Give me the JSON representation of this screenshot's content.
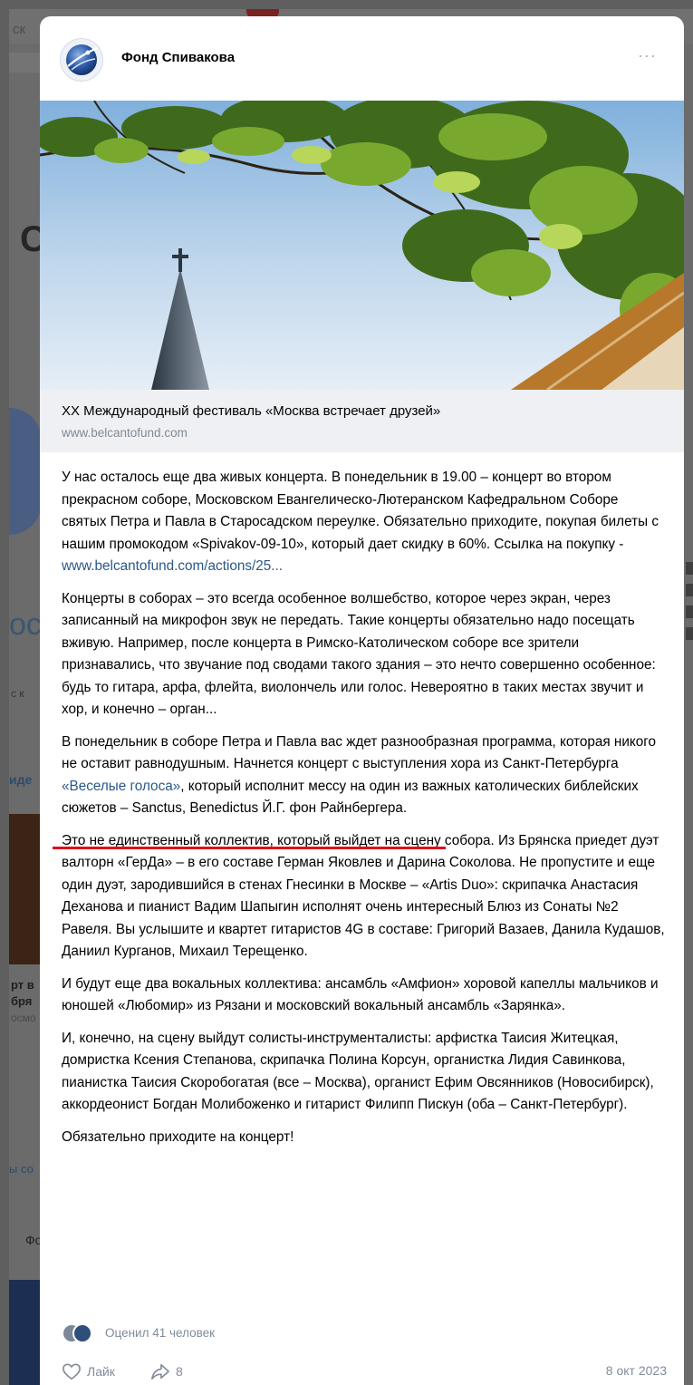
{
  "background": {
    "search_fragment": "ск",
    "big_letter": "С",
    "side_text_oc": "ос",
    "side_text_sk": "с к",
    "side_text_ide": "иде",
    "side_text_rt1": "рт в",
    "side_text_rt2": "бря",
    "side_text_rt3": "осмо",
    "side_text_ysc": "ы со",
    "side_text_fo": "Фо"
  },
  "post": {
    "author": "Фонд Спивакова",
    "menu_icon": "ellipsis-icon",
    "link_preview": {
      "title": "XX Международный фестиваль «Москва встречает друзей»",
      "domain": "www.belcantofund.com"
    },
    "paragraphs": {
      "p1": "У нас осталось еще два живых концерта. В понедельник в 19.00 – концерт во втором прекрасном соборе, Московском Евангелическо-Лютеранском Кафедральном Соборе святых Петра и Павла в Старосадском переулке. Обязательно приходите, покупая билеты с нашим промокодом «Spivakov-09-10», который дает скидку в 60%. Ссылка на покупку - ",
      "p1_link": "www.belcantofund.com/actions/25...",
      "p2": "Концерты в соборах – это всегда особенное волшебство, которое через экран, через записанный на микрофон звук не передать. Такие концерты обязательно надо посещать вживую. Например, после концерта в Римско-Католическом соборе все зрители признавались, что звучание под сводами такого здания – это нечто совершенно особенное: будь то гитара, арфа, флейта, виолончель или голос. Невероятно в таких местах звучит и хор, и конечно – орган...",
      "p3_before": "В понедельник в соборе Петра и Павла вас ждет разнообразная программа, которая никого не оставит равнодушным. Начнется концерт с выступления хора из Санкт-Петербурга ",
      "p3_link": "«Веселые голоса»",
      "p3_after": ", который исполнит мессу на один из важных католических библейских сюжетов – Sanctus, Benedictus Й.Г. фон Райнбергера.",
      "p4": "Это не единственный коллектив, который выйдет на сцену собора. Из Брянска приедет дуэт валторн «ГерДа» – в его составе Герман Яковлев и Дарина Соколова. Не пропустите и еще один дуэт, зародившийся в стенах Гнесинки в Москве – «Artis Duo»: скрипачка Анастасия Деханова и пианист Вадим Шапыгин исполнят очень интересный Блюз из Сонаты №2 Равеля. Вы услышите и квартет гитаристов 4G в составе: Григорий Вазаев, Данила Кудашов, Даниил Курганов, Михаил Терещенко.",
      "p5": "И будут еще два вокальных коллектива: ансамбль «Амфион» хоровой капеллы мальчиков и юношей «Любомир» из Рязани и московский вокальный ансамбль «Зарянка».",
      "p6": "И, конечно, на сцену выйдут солисты-инструменталисты: арфистка Таисия Житецкая, домристка Ксения Степанова, скрипачка Полина Корсун, органистка Лидия Савинкова, пианистка Таисия Скоробогатая (все – Москва), органист Ефим Овсянников (Новосибирск), аккордеонист Богдан Молибоженко и гитарист Филипп Пискун (оба – Санкт-Петербург).",
      "p7": "Обязательно приходите на концерт!"
    },
    "likes_summary": "Оценил 41 человек",
    "like_label": "Лайк",
    "share_count": "8",
    "date": "8 окт 2023"
  },
  "colors": {
    "link": "#2a5885",
    "muted": "#818c99",
    "underline_annotation": "#e0101a",
    "backdrop": "#5f5f5f"
  }
}
